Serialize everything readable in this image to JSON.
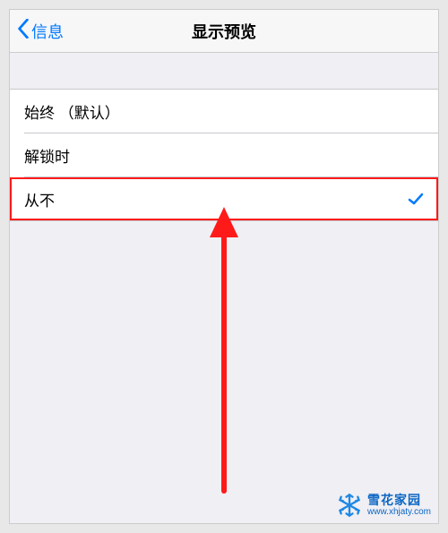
{
  "nav": {
    "back_label": "信息",
    "title": "显示预览"
  },
  "options": [
    {
      "label": "始终 （默认）",
      "selected": false
    },
    {
      "label": "解锁时",
      "selected": false
    },
    {
      "label": "从不",
      "selected": true
    }
  ],
  "watermark": {
    "line1": "雪花家园",
    "line2": "www.xhjaty.com"
  },
  "colors": {
    "accent": "#007aff",
    "highlight": "#ff1a1a",
    "brand": "#0b66c3"
  }
}
